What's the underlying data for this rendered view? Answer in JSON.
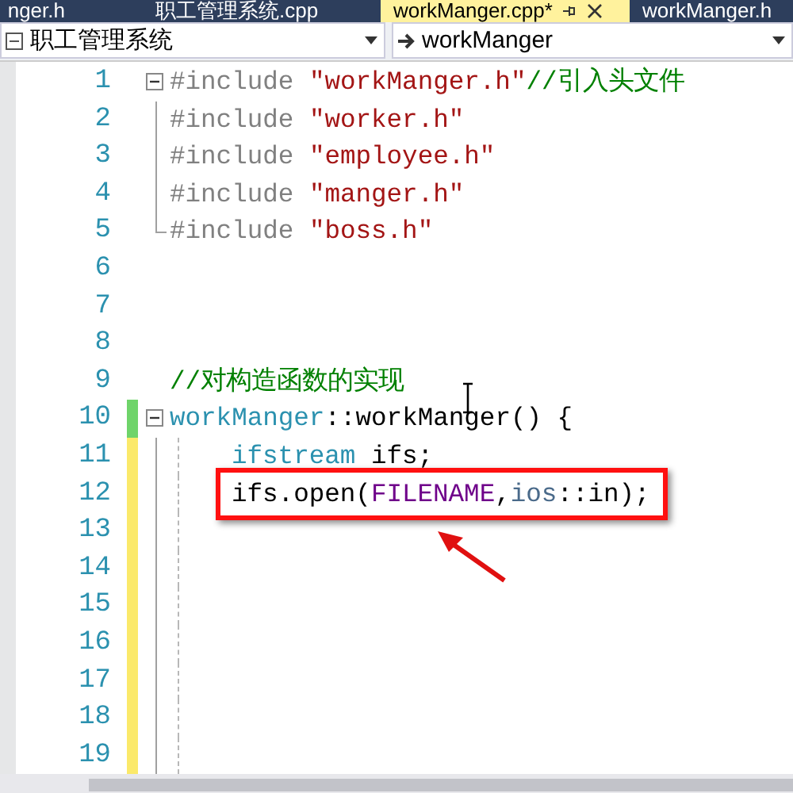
{
  "tabs": [
    {
      "label": "nger.h",
      "selected": false
    },
    {
      "label": "职工管理系统.cpp",
      "selected": false
    },
    {
      "label": "workManger.cpp*",
      "selected": true
    },
    {
      "label": "workManger.h",
      "selected": false
    }
  ],
  "navigation": {
    "project": "职工管理系统",
    "scope": "workManger"
  },
  "lines": [
    {
      "number": "1",
      "changed": false,
      "expanded": true,
      "indent_guide": false,
      "tokens": [
        {
          "kind": "preprocessor",
          "text": "#include "
        },
        {
          "kind": "string",
          "text": "\"workManger.h\""
        },
        {
          "kind": "comment",
          "text": "//引入头文件"
        }
      ]
    },
    {
      "number": "2",
      "changed": false,
      "in_fold": true,
      "fold_end": false,
      "indent_guide": false,
      "tokens": [
        {
          "kind": "preprocessor",
          "text": "#include "
        },
        {
          "kind": "string",
          "text": "\"worker.h\""
        }
      ]
    },
    {
      "number": "3",
      "changed": false,
      "in_fold": true,
      "fold_end": false,
      "indent_guide": false,
      "tokens": [
        {
          "kind": "preprocessor",
          "text": "#include "
        },
        {
          "kind": "string",
          "text": "\"employee.h\""
        }
      ]
    },
    {
      "number": "4",
      "changed": false,
      "in_fold": true,
      "fold_end": false,
      "indent_guide": false,
      "tokens": [
        {
          "kind": "preprocessor",
          "text": "#include "
        },
        {
          "kind": "string",
          "text": "\"manger.h\""
        }
      ]
    },
    {
      "number": "5",
      "changed": false,
      "in_fold": true,
      "fold_end": true,
      "indent_guide": false,
      "tokens": [
        {
          "kind": "preprocessor",
          "text": "#include "
        },
        {
          "kind": "string",
          "text": "\"boss.h\""
        }
      ]
    },
    {
      "number": "6",
      "changed": false,
      "in_fold": false,
      "indent_guide": false
    },
    {
      "number": "7",
      "changed": false,
      "in_fold": false,
      "indent_guide": false
    },
    {
      "number": "8",
      "changed": false,
      "in_fold": false,
      "indent_guide": false
    },
    {
      "number": "9",
      "changed": false,
      "in_fold": false,
      "indent_guide": false,
      "tokens": [
        {
          "kind": "comment",
          "text": "//对构造函数的实现"
        }
      ]
    },
    {
      "number": "10",
      "changed": true,
      "saved": true,
      "expanded": true,
      "indent_guide": false,
      "tokens": [
        {
          "kind": "type",
          "text": "workManger"
        },
        {
          "kind": "plain",
          "text": "::workManger() {"
        }
      ]
    },
    {
      "number": "11",
      "changed": true,
      "saved": false,
      "in_fold": true,
      "fold_end": false,
      "indent_guide": true,
      "tokens": [
        {
          "kind": "type",
          "text": "ifstream"
        },
        {
          "kind": "plain",
          "text": " ifs;"
        }
      ]
    },
    {
      "number": "12",
      "changed": true,
      "saved": false,
      "in_fold": true,
      "fold_end": false,
      "indent_guide": true,
      "highlighted": true,
      "tokens": [
        {
          "kind": "plain",
          "text": "ifs.open("
        },
        {
          "kind": "macro",
          "text": "FILENAME"
        },
        {
          "kind": "plain",
          "text": ","
        },
        {
          "kind": "namespace",
          "text": "ios"
        },
        {
          "kind": "plain",
          "text": "::in);"
        }
      ]
    },
    {
      "number": "13",
      "changed": true,
      "saved": false,
      "in_fold": true,
      "fold_end": false,
      "indent_guide": true
    },
    {
      "number": "14",
      "changed": true,
      "saved": false,
      "in_fold": true,
      "fold_end": false,
      "indent_guide": true
    },
    {
      "number": "15",
      "changed": true,
      "saved": false,
      "in_fold": true,
      "fold_end": false,
      "indent_guide": true
    },
    {
      "number": "16",
      "changed": true,
      "saved": false,
      "in_fold": true,
      "fold_end": false,
      "indent_guide": true
    },
    {
      "number": "17",
      "changed": true,
      "saved": false,
      "in_fold": true,
      "fold_end": false,
      "indent_guide": true
    },
    {
      "number": "18",
      "changed": true,
      "saved": false,
      "in_fold": true,
      "fold_end": false,
      "indent_guide": true
    },
    {
      "number": "19",
      "changed": true,
      "saved": false,
      "in_fold": true,
      "fold_end": false,
      "indent_guide": true
    }
  ]
}
